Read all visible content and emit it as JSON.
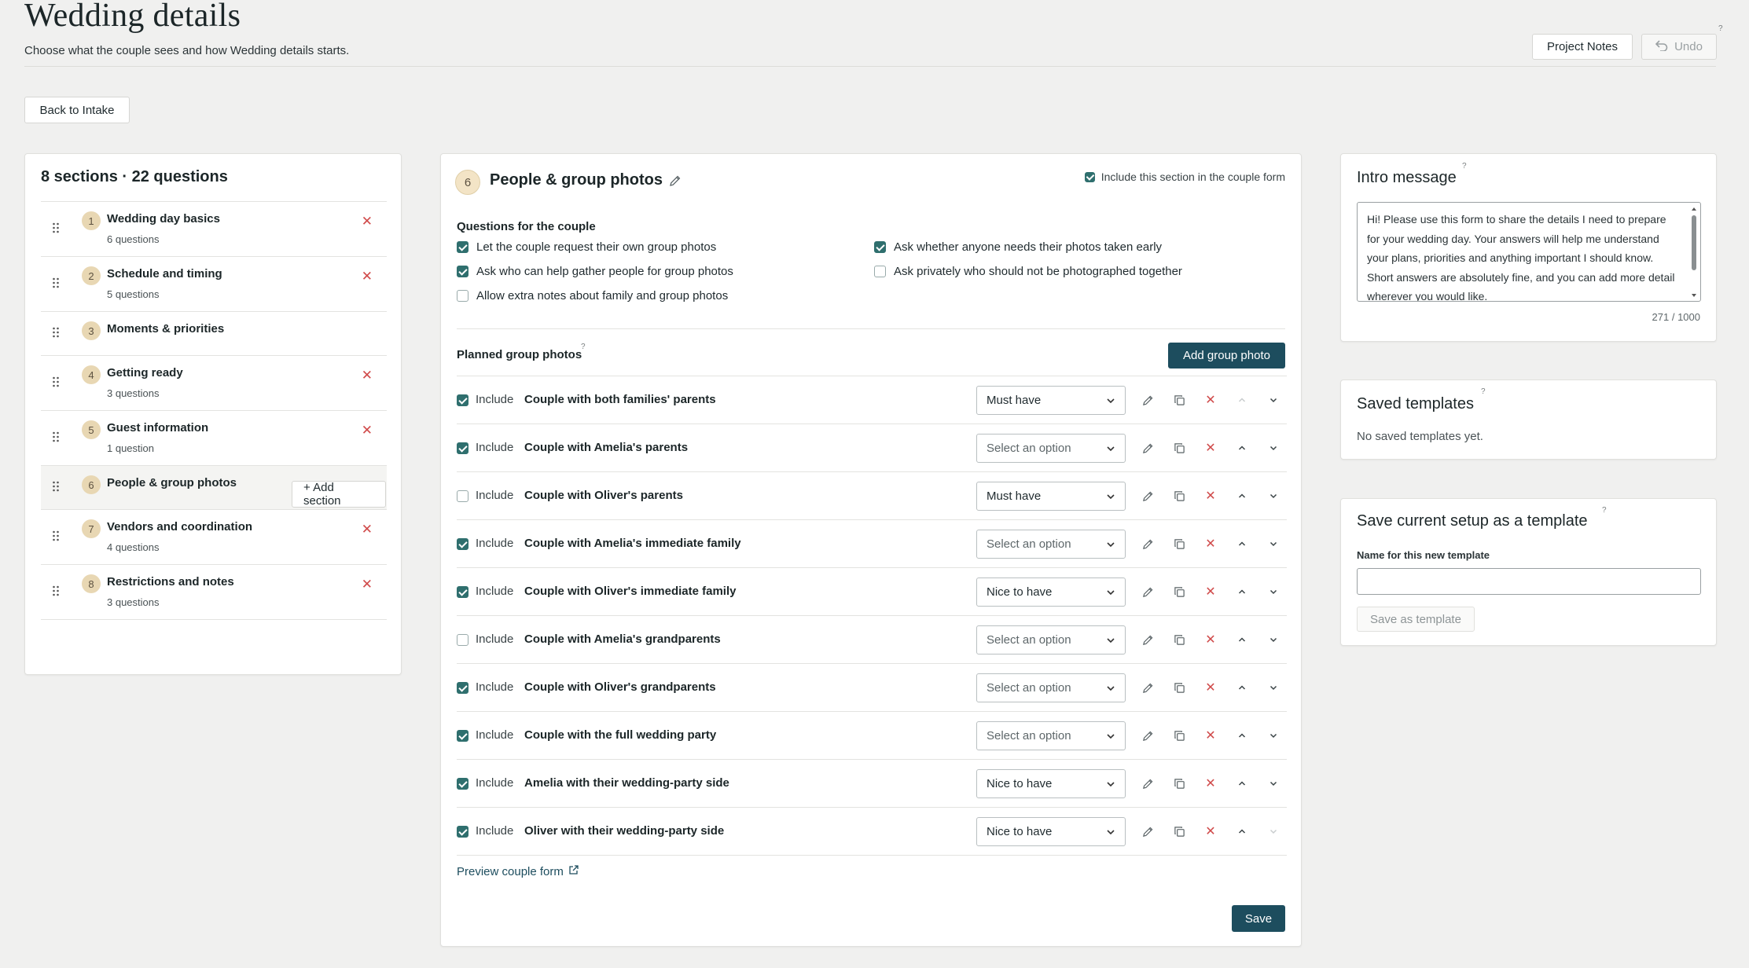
{
  "header": {
    "title": "Wedding details",
    "subtitle": "Choose what the couple sees and how Wedding details starts.",
    "project_notes_label": "Project Notes",
    "undo_label": "Undo",
    "help_mark": "?"
  },
  "back_button": {
    "label": "Back to Intake"
  },
  "sections_panel": {
    "summary": "8 sections · 22 questions",
    "add_section_label": "+ Add section",
    "items": [
      {
        "number": "1",
        "title": "Wedding day basics",
        "count": "6 questions",
        "removable": true
      },
      {
        "number": "2",
        "title": "Schedule and timing",
        "count": "5 questions",
        "removable": true
      },
      {
        "number": "3",
        "title": "Moments & priorities",
        "count": "",
        "removable": false
      },
      {
        "number": "4",
        "title": "Getting ready",
        "count": "3 questions",
        "removable": true
      },
      {
        "number": "5",
        "title": "Guest information",
        "count": "1 question",
        "removable": true
      },
      {
        "number": "6",
        "title": "People & group photos",
        "count": "",
        "removable": false,
        "active": true
      },
      {
        "number": "7",
        "title": "Vendors and coordination",
        "count": "4 questions",
        "removable": true
      },
      {
        "number": "8",
        "title": "Restrictions and notes",
        "count": "3 questions",
        "removable": true
      }
    ]
  },
  "editor": {
    "section_number": "6",
    "section_title": "People & group photos",
    "include_section_label": "Include this section in the couple form",
    "include_section_checked": true,
    "questions_heading": "Questions for the couple",
    "questions": [
      {
        "label": "Let the couple request their own group photos",
        "checked": true
      },
      {
        "label": "Ask who can help gather people for group photos",
        "checked": true
      },
      {
        "label": "Allow extra notes about family and group photos",
        "checked": false
      },
      {
        "label": "Ask whether anyone needs their photos taken early",
        "checked": true
      },
      {
        "label": "Ask privately who should not be photographed together",
        "checked": false
      }
    ],
    "planned_heading": "Planned group photos",
    "help_mark": "?",
    "add_photo_label": "Add group photo",
    "include_label": "Include",
    "photos": [
      {
        "name": "Couple with both families' parents",
        "checked": true,
        "priority": "Must have"
      },
      {
        "name": "Couple with Amelia's parents",
        "checked": true,
        "priority": "Select an option"
      },
      {
        "name": "Couple with Oliver's parents",
        "checked": false,
        "priority": "Must have"
      },
      {
        "name": "Couple with Amelia's immediate family",
        "checked": true,
        "priority": "Select an option"
      },
      {
        "name": "Couple with Oliver's immediate family",
        "checked": true,
        "priority": "Nice to have"
      },
      {
        "name": "Couple with Amelia's grandparents",
        "checked": false,
        "priority": "Select an option"
      },
      {
        "name": "Couple with Oliver's grandparents",
        "checked": true,
        "priority": "Select an option"
      },
      {
        "name": "Couple with the full wedding party",
        "checked": true,
        "priority": "Select an option"
      },
      {
        "name": "Amelia with their wedding-party side",
        "checked": true,
        "priority": "Nice to have"
      },
      {
        "name": "Oliver with their wedding-party side",
        "checked": true,
        "priority": "Nice to have"
      }
    ],
    "preview_label": "Preview couple form",
    "save_label": "Save"
  },
  "intro": {
    "title": "Intro message",
    "help_mark": "?",
    "text": "Hi! Please use this form to share the details I need to prepare for your wedding day. Your answers will help me understand your plans, priorities and anything important I should know. Short answers are absolutely fine, and you can add more detail wherever you would like.",
    "char_count": "271 / 1000"
  },
  "saved_templates": {
    "title": "Saved templates",
    "help_mark": "?",
    "empty_text": "No saved templates yet."
  },
  "save_template": {
    "title": "Save current setup as a template",
    "help_mark": "?",
    "name_label": "Name for this new template",
    "name_value": "",
    "button_label": "Save as template"
  },
  "colors": {
    "accent": "#1d4d5e",
    "checkbox": "#2f6f6e",
    "badge": "#e8d7b3",
    "remove": "#d04a4a",
    "background": "#f0f0ef"
  }
}
